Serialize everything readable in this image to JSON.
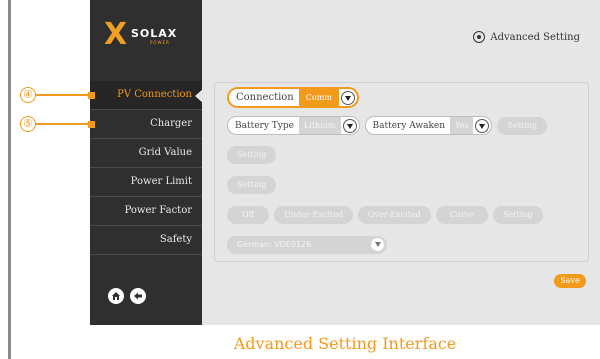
{
  "brand": {
    "mark": "X",
    "name": "SOLAX",
    "tagline": "POWER"
  },
  "header": {
    "title": "Advanced Setting"
  },
  "sidebar": {
    "items": [
      {
        "label": "PV Connection",
        "active": true
      },
      {
        "label": "Charger"
      },
      {
        "label": "Grid Value"
      },
      {
        "label": "Power Limit"
      },
      {
        "label": "Power Factor"
      },
      {
        "label": "Safety"
      }
    ]
  },
  "pv_connection": {
    "label": "Connection",
    "value": "Comm"
  },
  "charger": {
    "battery_type_label": "Battery Type",
    "battery_type_value": "Lithium",
    "battery_awaken_label": "Battery Awaken",
    "battery_awaken_value": "Yes",
    "setting_label": "Setting"
  },
  "grid_value": {
    "setting_label": "Setting"
  },
  "power_limit": {
    "setting_label": "Setting"
  },
  "power_factor": {
    "options": [
      "Off",
      "Under-Excited",
      "Over-Excited",
      "Curve"
    ],
    "setting_label": "Setting"
  },
  "safety": {
    "country": "German: VDE0126"
  },
  "save_label": "Save",
  "markers": {
    "first": "④",
    "second": "⑤"
  },
  "caption": "Advanced Setting Interface",
  "colors": {
    "accent": "#f19a1c",
    "sidebar": "#2f2f2f",
    "panel": "#e6e6e6",
    "disabled": "#d4d4d4"
  },
  "icons": {
    "home": "home-icon",
    "back": "back-arrow-icon",
    "settings": "gear-icon"
  }
}
